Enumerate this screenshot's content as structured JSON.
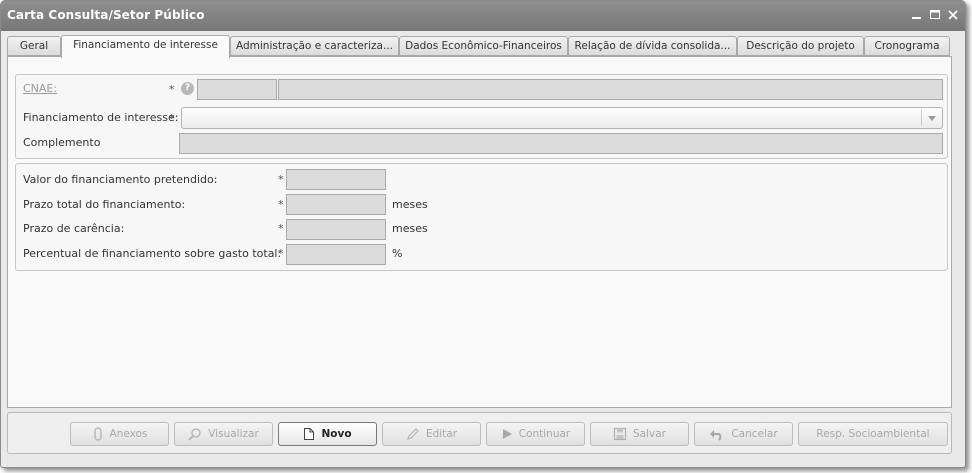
{
  "window": {
    "title": "Carta Consulta/Setor Público"
  },
  "tabs": [
    {
      "label": "Geral"
    },
    {
      "label": "Financiamento de interesse"
    },
    {
      "label": "Administração e caracteriza..."
    },
    {
      "label": "Dados Econômico-Financeiros"
    },
    {
      "label": "Relação de dívida consolida..."
    },
    {
      "label": "Descrição do projeto"
    },
    {
      "label": "Cronograma"
    }
  ],
  "form": {
    "cnae": {
      "label": "CNAE:",
      "required": "*",
      "help": "?",
      "code": "",
      "description": ""
    },
    "financiamento": {
      "label": "Financiamento de interesse:",
      "required": "*",
      "value": ""
    },
    "complemento": {
      "label": "Complemento",
      "value": ""
    }
  },
  "values": {
    "valor": {
      "label": "Valor do financiamento pretendido:",
      "required": "*",
      "value": ""
    },
    "prazo_total": {
      "label": "Prazo total do financiamento:",
      "required": "*",
      "value": "",
      "unit": "meses"
    },
    "prazo_carencia": {
      "label": "Prazo de carência:",
      "required": "*",
      "value": "",
      "unit": "meses"
    },
    "percentual": {
      "label": "Percentual de financiamento sobre gasto total:",
      "required": "*",
      "value": "",
      "unit": "%"
    }
  },
  "buttons": [
    {
      "label": "Anexos",
      "icon": "clip-icon",
      "enabled": false
    },
    {
      "label": "Visualizar",
      "icon": "magnifier-icon",
      "enabled": false
    },
    {
      "label": "Novo",
      "icon": "new-document-icon",
      "enabled": true
    },
    {
      "label": "Editar",
      "icon": "pencil-icon",
      "enabled": false
    },
    {
      "label": "Continuar",
      "icon": "play-icon",
      "enabled": false
    },
    {
      "label": "Salvar",
      "icon": "floppy-icon",
      "enabled": false
    },
    {
      "label": "Cancelar",
      "icon": "undo-icon",
      "enabled": false
    },
    {
      "label": "Resp. Socioambiental",
      "icon": "",
      "enabled": false
    }
  ],
  "colors": {
    "titlebar": "#808080",
    "field_disabled": "#dcdcdc",
    "border": "#a9a9a9"
  }
}
